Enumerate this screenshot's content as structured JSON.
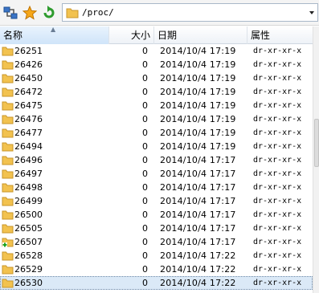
{
  "toolbar": {
    "icons": [
      "connect-icon",
      "bookmark-star-icon",
      "refresh-icon"
    ],
    "path": "/proc/"
  },
  "columns": {
    "name": "名称",
    "size": "大小",
    "date": "日期",
    "attr": "属性"
  },
  "rows": [
    {
      "name": "26251",
      "size": "0",
      "date": "2014/10/4  17:19",
      "attr": "dr-xr-xr-x"
    },
    {
      "name": "26426",
      "size": "0",
      "date": "2014/10/4  17:19",
      "attr": "dr-xr-xr-x"
    },
    {
      "name": "26450",
      "size": "0",
      "date": "2014/10/4  17:19",
      "attr": "dr-xr-xr-x"
    },
    {
      "name": "26472",
      "size": "0",
      "date": "2014/10/4  17:19",
      "attr": "dr-xr-xr-x"
    },
    {
      "name": "26475",
      "size": "0",
      "date": "2014/10/4  17:19",
      "attr": "dr-xr-xr-x"
    },
    {
      "name": "26476",
      "size": "0",
      "date": "2014/10/4  17:19",
      "attr": "dr-xr-xr-x"
    },
    {
      "name": "26477",
      "size": "0",
      "date": "2014/10/4  17:19",
      "attr": "dr-xr-xr-x"
    },
    {
      "name": "26494",
      "size": "0",
      "date": "2014/10/4  17:19",
      "attr": "dr-xr-xr-x"
    },
    {
      "name": "26496",
      "size": "0",
      "date": "2014/10/4  17:17",
      "attr": "dr-xr-xr-x"
    },
    {
      "name": "26497",
      "size": "0",
      "date": "2014/10/4  17:17",
      "attr": "dr-xr-xr-x"
    },
    {
      "name": "26498",
      "size": "0",
      "date": "2014/10/4  17:17",
      "attr": "dr-xr-xr-x"
    },
    {
      "name": "26499",
      "size": "0",
      "date": "2014/10/4  17:17",
      "attr": "dr-xr-xr-x"
    },
    {
      "name": "26500",
      "size": "0",
      "date": "2014/10/4  17:17",
      "attr": "dr-xr-xr-x"
    },
    {
      "name": "26505",
      "size": "0",
      "date": "2014/10/4  17:17",
      "attr": "dr-xr-xr-x"
    },
    {
      "name": "26507",
      "size": "0",
      "date": "2014/10/4  17:17",
      "attr": "dr-xr-xr-x",
      "badge": "plus-badge-icon"
    },
    {
      "name": "26528",
      "size": "0",
      "date": "2014/10/4  17:22",
      "attr": "dr-xr-xr-x"
    },
    {
      "name": "26529",
      "size": "0",
      "date": "2014/10/4  17:22",
      "attr": "dr-xr-xr-x"
    },
    {
      "name": "26530",
      "size": "0",
      "date": "2014/10/4  17:22",
      "attr": "dr-xr-xr-x",
      "selected": true
    }
  ],
  "colors": {
    "selection": "#dbe9f7",
    "folder": "#f2c24f",
    "header_sorted": "#cfe4f9"
  }
}
